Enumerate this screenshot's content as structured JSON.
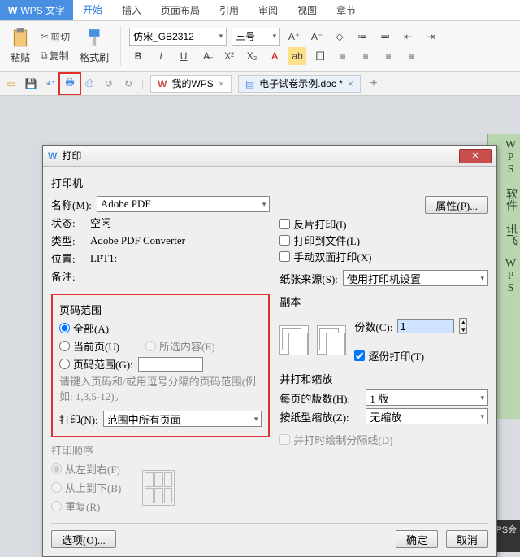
{
  "app": {
    "logo_letter": "W",
    "title": "WPS 文字"
  },
  "menu": {
    "items": [
      "开始",
      "插入",
      "页面布局",
      "引用",
      "审阅",
      "视图",
      "章节"
    ],
    "active_index": 0
  },
  "ribbon": {
    "paste_label": "粘贴",
    "cut_label": "剪切",
    "copy_label": "复制",
    "format_painter_label": "格式刷",
    "font_name": "仿宋_GB2312",
    "font_size": "三号",
    "buttons": {
      "bold": "B",
      "italic": "I",
      "underline": "U",
      "strike": "A",
      "super": "X²",
      "sub": "X₂",
      "fontA": "A",
      "bullets": "≡"
    }
  },
  "qat": {
    "icons": [
      "folder",
      "save",
      "undo",
      "print",
      "refresh",
      "back",
      "forward"
    ],
    "mywps": "我的WPS",
    "doc_tab": "电子试卷示例.doc *"
  },
  "dialog": {
    "title": "打印",
    "printer_section": "打印机",
    "name_label": "名称(M):",
    "name_value": "Adobe PDF",
    "properties_btn": "属性(P)...",
    "status_label": "状态:",
    "status_value": "空闲",
    "type_label": "类型:",
    "type_value": "Adobe PDF Converter",
    "where_label": "位置:",
    "where_value": "LPT1:",
    "comment_label": "备注:",
    "reverse_print": "反片打印(I)",
    "print_to_file": "打印到文件(L)",
    "duplex_manual": "手动双面打印(X)",
    "paper_source_label": "纸张来源(S):",
    "paper_source_value": "使用打印机设置",
    "page_range_title": "页码范围",
    "range_all": "全部(A)",
    "range_current": "当前页(U)",
    "range_selection": "所选内容(E)",
    "range_pages": "页码范围(G):",
    "range_pages_value": "",
    "range_hint": "请键入页码和/或用逗号分隔的页码范围(例如: 1,3,5-12)。",
    "print_what_label": "打印(N):",
    "print_what_value": "范围中所有页面",
    "print_order_title": "打印顺序",
    "order_ltr": "从左到右(F)",
    "order_ttb": "从上到下(B)",
    "order_repeat": "重复(R)",
    "copies_title": "副本",
    "copies_label": "份数(C):",
    "copies_value": "1",
    "collate": "逐份打印(T)",
    "scale_title": "并打和缩放",
    "pages_per_sheet_label": "每页的版数(H):",
    "pages_per_sheet_value": "1 版",
    "scale_to_label": "按纸型缩放(Z):",
    "scale_to_value": "无缩放",
    "draw_lines": "并打时绘制分隔线(D)",
    "options_btn": "选项(O)...",
    "ok_btn": "确定",
    "cancel_btn": "取消"
  },
  "side": {
    "lines": "WPS 软件 讯飞 WPS"
  },
  "bottom": {
    "label": "WPS会员"
  }
}
